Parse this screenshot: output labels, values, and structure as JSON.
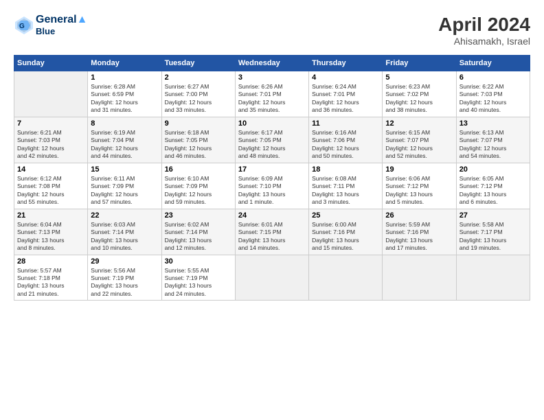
{
  "header": {
    "logo_line1": "General",
    "logo_line2": "Blue",
    "month": "April 2024",
    "location": "Ahisamakh, Israel"
  },
  "columns": [
    "Sunday",
    "Monday",
    "Tuesday",
    "Wednesday",
    "Thursday",
    "Friday",
    "Saturday"
  ],
  "weeks": [
    [
      {
        "day": "",
        "info": ""
      },
      {
        "day": "1",
        "info": "Sunrise: 6:28 AM\nSunset: 6:59 PM\nDaylight: 12 hours\nand 31 minutes."
      },
      {
        "day": "2",
        "info": "Sunrise: 6:27 AM\nSunset: 7:00 PM\nDaylight: 12 hours\nand 33 minutes."
      },
      {
        "day": "3",
        "info": "Sunrise: 6:26 AM\nSunset: 7:01 PM\nDaylight: 12 hours\nand 35 minutes."
      },
      {
        "day": "4",
        "info": "Sunrise: 6:24 AM\nSunset: 7:01 PM\nDaylight: 12 hours\nand 36 minutes."
      },
      {
        "day": "5",
        "info": "Sunrise: 6:23 AM\nSunset: 7:02 PM\nDaylight: 12 hours\nand 38 minutes."
      },
      {
        "day": "6",
        "info": "Sunrise: 6:22 AM\nSunset: 7:03 PM\nDaylight: 12 hours\nand 40 minutes."
      }
    ],
    [
      {
        "day": "7",
        "info": "Sunrise: 6:21 AM\nSunset: 7:03 PM\nDaylight: 12 hours\nand 42 minutes."
      },
      {
        "day": "8",
        "info": "Sunrise: 6:19 AM\nSunset: 7:04 PM\nDaylight: 12 hours\nand 44 minutes."
      },
      {
        "day": "9",
        "info": "Sunrise: 6:18 AM\nSunset: 7:05 PM\nDaylight: 12 hours\nand 46 minutes."
      },
      {
        "day": "10",
        "info": "Sunrise: 6:17 AM\nSunset: 7:05 PM\nDaylight: 12 hours\nand 48 minutes."
      },
      {
        "day": "11",
        "info": "Sunrise: 6:16 AM\nSunset: 7:06 PM\nDaylight: 12 hours\nand 50 minutes."
      },
      {
        "day": "12",
        "info": "Sunrise: 6:15 AM\nSunset: 7:07 PM\nDaylight: 12 hours\nand 52 minutes."
      },
      {
        "day": "13",
        "info": "Sunrise: 6:13 AM\nSunset: 7:07 PM\nDaylight: 12 hours\nand 54 minutes."
      }
    ],
    [
      {
        "day": "14",
        "info": "Sunrise: 6:12 AM\nSunset: 7:08 PM\nDaylight: 12 hours\nand 55 minutes."
      },
      {
        "day": "15",
        "info": "Sunrise: 6:11 AM\nSunset: 7:09 PM\nDaylight: 12 hours\nand 57 minutes."
      },
      {
        "day": "16",
        "info": "Sunrise: 6:10 AM\nSunset: 7:09 PM\nDaylight: 12 hours\nand 59 minutes."
      },
      {
        "day": "17",
        "info": "Sunrise: 6:09 AM\nSunset: 7:10 PM\nDaylight: 13 hours\nand 1 minute."
      },
      {
        "day": "18",
        "info": "Sunrise: 6:08 AM\nSunset: 7:11 PM\nDaylight: 13 hours\nand 3 minutes."
      },
      {
        "day": "19",
        "info": "Sunrise: 6:06 AM\nSunset: 7:12 PM\nDaylight: 13 hours\nand 5 minutes."
      },
      {
        "day": "20",
        "info": "Sunrise: 6:05 AM\nSunset: 7:12 PM\nDaylight: 13 hours\nand 6 minutes."
      }
    ],
    [
      {
        "day": "21",
        "info": "Sunrise: 6:04 AM\nSunset: 7:13 PM\nDaylight: 13 hours\nand 8 minutes."
      },
      {
        "day": "22",
        "info": "Sunrise: 6:03 AM\nSunset: 7:14 PM\nDaylight: 13 hours\nand 10 minutes."
      },
      {
        "day": "23",
        "info": "Sunrise: 6:02 AM\nSunset: 7:14 PM\nDaylight: 13 hours\nand 12 minutes."
      },
      {
        "day": "24",
        "info": "Sunrise: 6:01 AM\nSunset: 7:15 PM\nDaylight: 13 hours\nand 14 minutes."
      },
      {
        "day": "25",
        "info": "Sunrise: 6:00 AM\nSunset: 7:16 PM\nDaylight: 13 hours\nand 15 minutes."
      },
      {
        "day": "26",
        "info": "Sunrise: 5:59 AM\nSunset: 7:16 PM\nDaylight: 13 hours\nand 17 minutes."
      },
      {
        "day": "27",
        "info": "Sunrise: 5:58 AM\nSunset: 7:17 PM\nDaylight: 13 hours\nand 19 minutes."
      }
    ],
    [
      {
        "day": "28",
        "info": "Sunrise: 5:57 AM\nSunset: 7:18 PM\nDaylight: 13 hours\nand 21 minutes."
      },
      {
        "day": "29",
        "info": "Sunrise: 5:56 AM\nSunset: 7:19 PM\nDaylight: 13 hours\nand 22 minutes."
      },
      {
        "day": "30",
        "info": "Sunrise: 5:55 AM\nSunset: 7:19 PM\nDaylight: 13 hours\nand 24 minutes."
      },
      {
        "day": "",
        "info": ""
      },
      {
        "day": "",
        "info": ""
      },
      {
        "day": "",
        "info": ""
      },
      {
        "day": "",
        "info": ""
      }
    ]
  ]
}
